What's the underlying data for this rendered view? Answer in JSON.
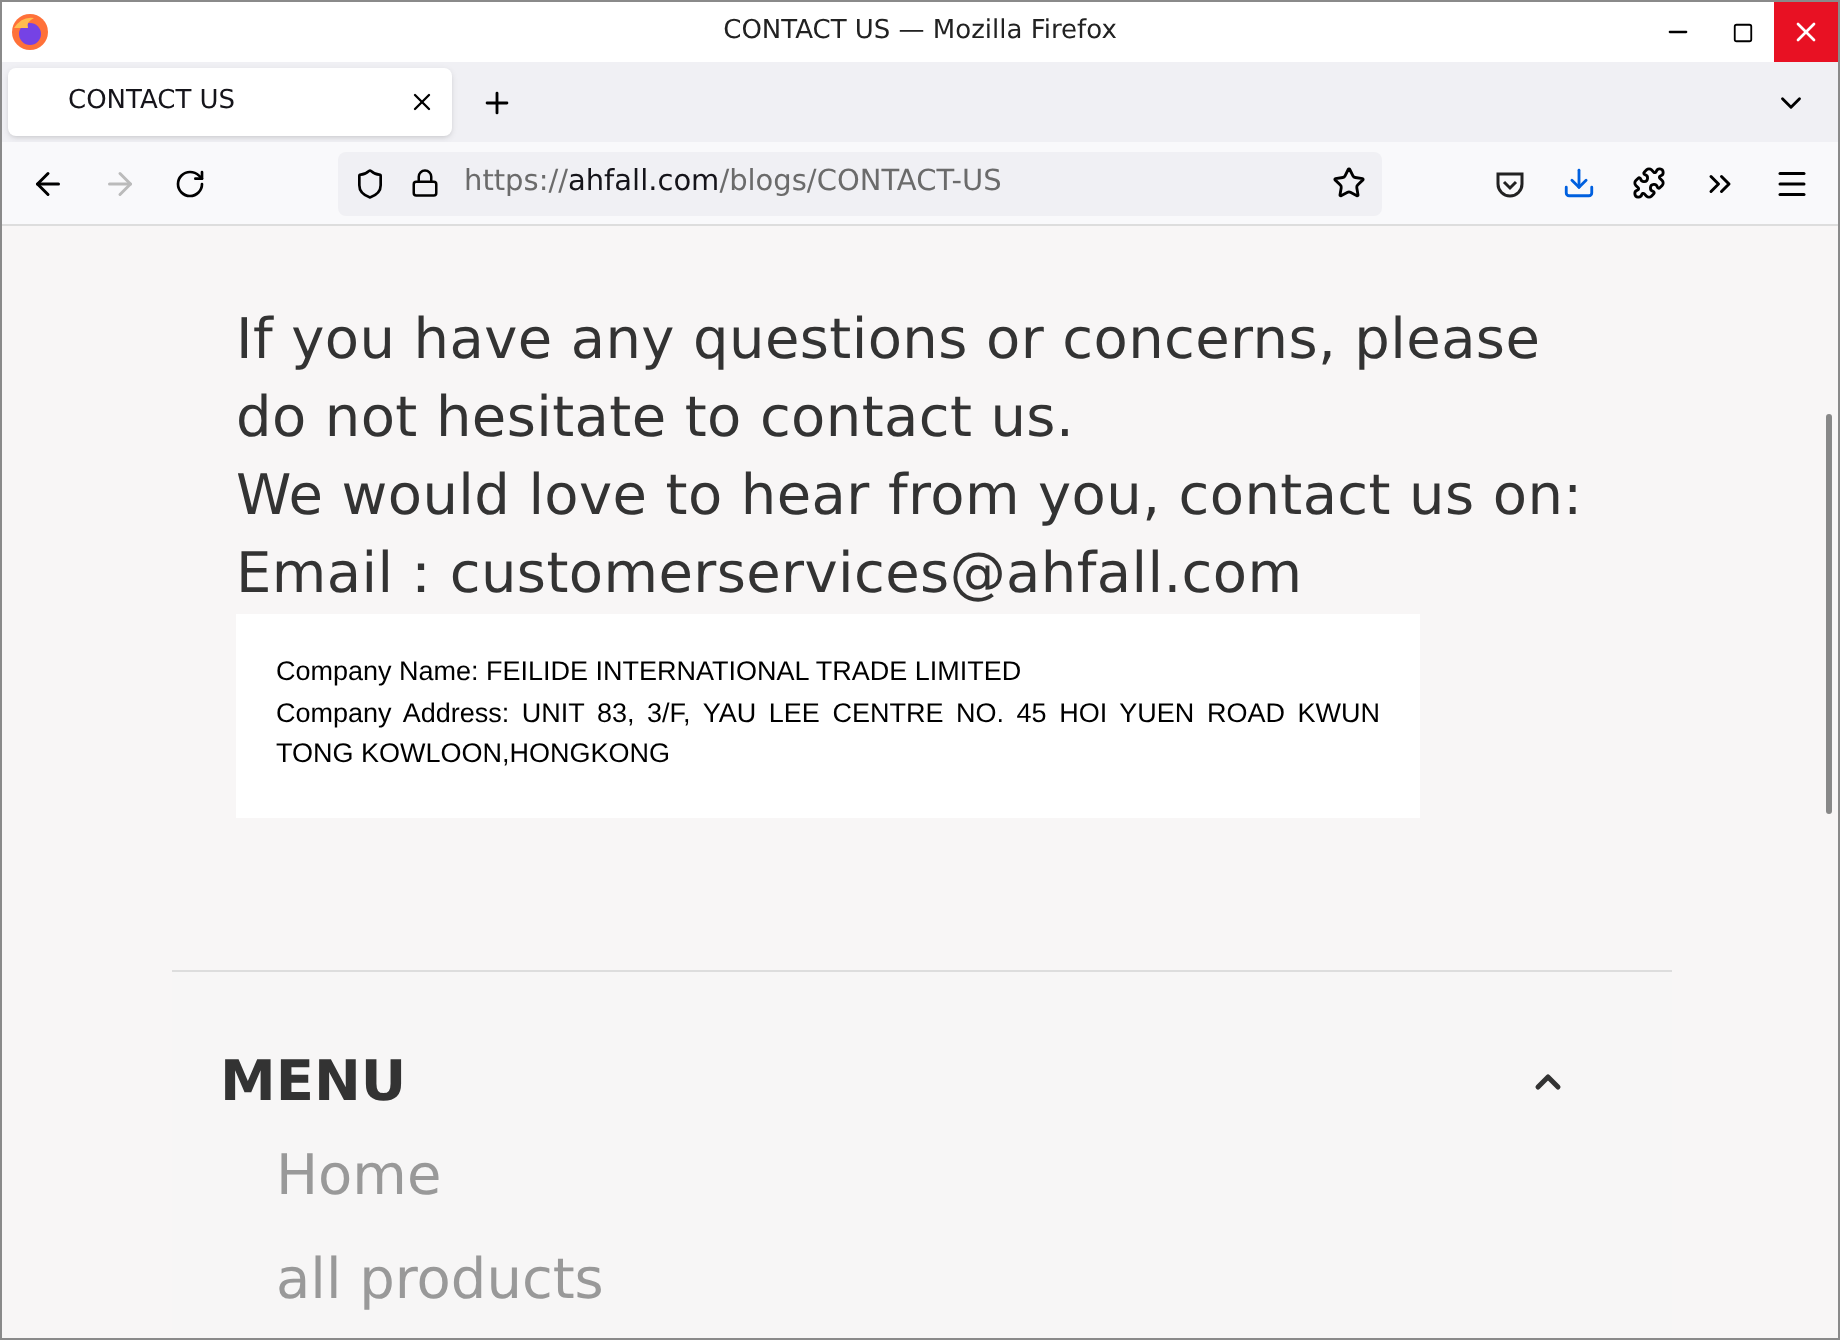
{
  "window": {
    "title": "CONTACT US — Mozilla Firefox"
  },
  "tabs": [
    {
      "label": "CONTACT US",
      "selected": true
    }
  ],
  "url": {
    "scheme": "https://",
    "host": "ahfall.com",
    "path": "/blogs/CONTACT-US"
  },
  "content": {
    "paragraphs": [
      "If you have any questions or concerns, please do not hesitate to contact us.",
      "We would love to hear from you, contact us on:",
      "Email：customerservices@ahfall.com"
    ],
    "company": [
      "Company Name: FEILIDE INTERNATIONAL TRADE LIMITED",
      "Company Address: UNIT 83, 3/F, YAU LEE CENTRE NO. 45 HOI YUEN ROAD KWUN TONG KOWLOON,HONGKONG"
    ]
  },
  "menu": {
    "title": "MENU",
    "expanded": true,
    "items": [
      "Home",
      "all products"
    ]
  }
}
